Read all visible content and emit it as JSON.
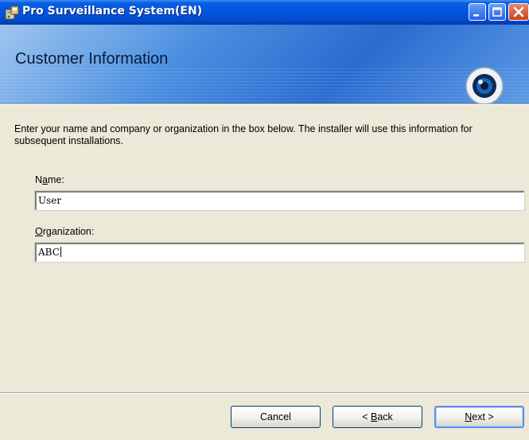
{
  "window": {
    "title": "Pro Surveillance System(EN)",
    "icons": {
      "app": "installer-icon",
      "minimize": "minimize-icon",
      "maximize": "maximize-icon",
      "close": "close-icon"
    }
  },
  "banner": {
    "title": "Customer Information",
    "graphic": "webcam-icon"
  },
  "instructions": "Enter your name and company or organization in the box below. The installer will use this information for subsequent installations.",
  "form": {
    "name": {
      "label_pre": "N",
      "label_accel": "a",
      "label_post": "me:",
      "value": "User"
    },
    "organization": {
      "label_pre": "",
      "label_accel": "O",
      "label_post": "rganization:",
      "value": "ABC"
    }
  },
  "buttons": {
    "cancel": "Cancel",
    "back": {
      "pre": "< ",
      "accel": "B",
      "post": "ack"
    },
    "next": {
      "pre": "",
      "accel": "N",
      "post": "ext >"
    }
  },
  "colors": {
    "titlebar": "#0054e3",
    "dialog": "#ece9d8",
    "banner": "#2a6bd0"
  }
}
